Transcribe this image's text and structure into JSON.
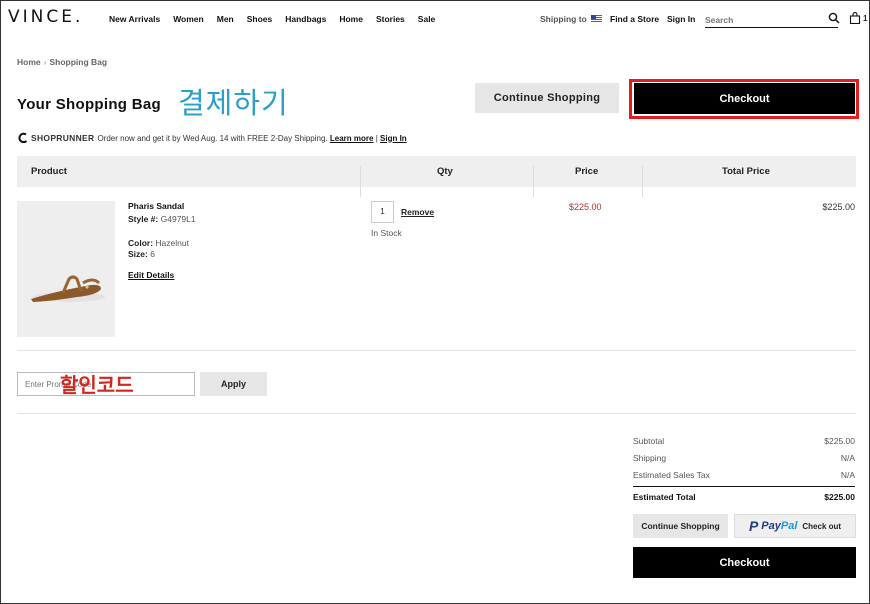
{
  "header": {
    "logo": "VINCE.",
    "nav": [
      "New Arrivals",
      "Women",
      "Men",
      "Shoes",
      "Handbags",
      "Home",
      "Stories",
      "Sale"
    ],
    "shipping_to": "Shipping to",
    "find_store": "Find a Store",
    "sign_in": "Sign In",
    "search_placeholder": "Search",
    "bag_count": "1"
  },
  "breadcrumb": [
    "Home",
    "Shopping Bag"
  ],
  "page_title": "Your Shopping Bag",
  "annotations": {
    "checkout": "결제하기",
    "promo": "할인코드"
  },
  "actions": {
    "continue_shopping": "Continue Shopping",
    "checkout": "Checkout"
  },
  "shoprunner": {
    "name": "SHOPRUNNER",
    "message": "Order now and get it by Wed Aug. 14 with FREE 2-Day Shipping.",
    "learn_more": "Learn more",
    "separator": "|",
    "sign_in": "Sign In"
  },
  "table": {
    "headers": [
      "Product",
      "Qty",
      "Price",
      "Total Price"
    ],
    "item": {
      "name": "Pharis Sandal",
      "style_label": "Style #:",
      "style": "G4979L1",
      "color_label": "Color:",
      "color": "Hazelnut",
      "size_label": "Size:",
      "size": "6",
      "edit": "Edit Details",
      "qty": "1",
      "remove": "Remove",
      "stock": "In Stock",
      "price": "$225.00",
      "total": "$225.00"
    }
  },
  "promo": {
    "placeholder": "Enter Promo Code",
    "apply": "Apply"
  },
  "summary": {
    "subtotal_label": "Subtotal",
    "subtotal": "$225.00",
    "shipping_label": "Shipping",
    "shipping": "N/A",
    "tax_label": "Estimated Sales Tax",
    "tax": "N/A",
    "total_label": "Estimated Total",
    "total": "$225.00",
    "continue_shopping": "Continue Shopping",
    "paypal_pay": "Pay",
    "paypal_pal": "Pal",
    "paypal_checkout": "Check out",
    "checkout": "Checkout"
  },
  "colors": {
    "accent_black": "#000000",
    "highlight_red": "#e01e1e",
    "price_red": "#aa3333",
    "annotation_blue": "#2a9fc9",
    "paypal_dark": "#253b80",
    "paypal_light": "#179bd7"
  }
}
